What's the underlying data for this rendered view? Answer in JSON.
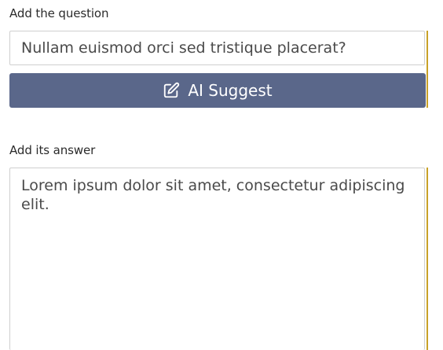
{
  "question": {
    "label": "Add the question",
    "value": "Nullam euismod orci sed tristique placerat?"
  },
  "ai_button": {
    "label": "AI Suggest",
    "icon": "edit-icon"
  },
  "answer": {
    "label": "Add its answer",
    "value": "Lorem ipsum dolor sit amet, consectetur adipiscing elit."
  },
  "colors": {
    "button_background": "#5a678a",
    "accent_line": "#c9a227"
  }
}
